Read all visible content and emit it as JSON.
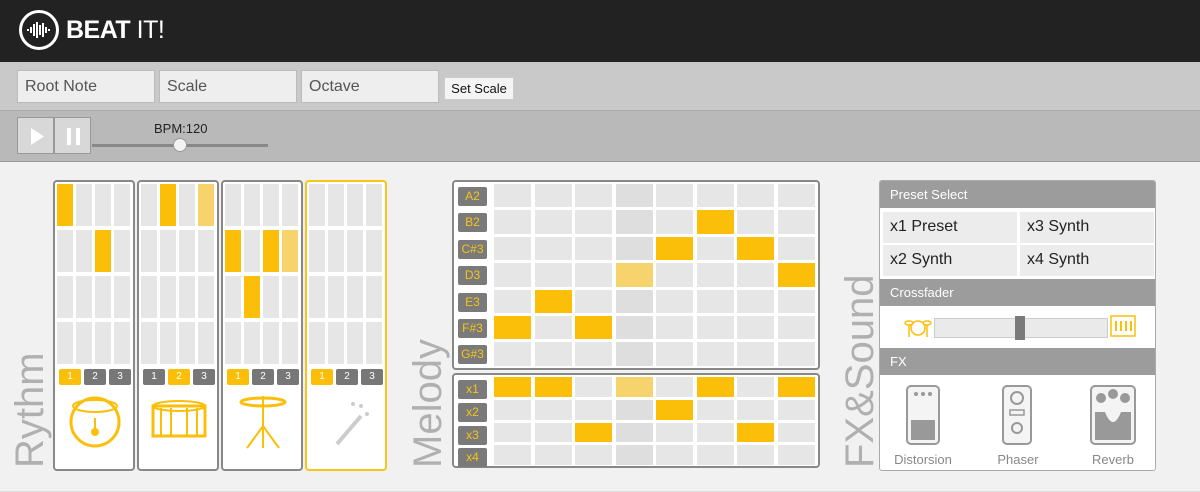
{
  "header": {
    "brand_bold": "BEAT",
    "brand_light": "IT!"
  },
  "scale_controls": {
    "root_note": "Root Note",
    "scale": "Scale",
    "octave": "Octave",
    "set_scale": "Set Scale"
  },
  "transport": {
    "bpm_label": "BPM:120",
    "bpm_value": 120,
    "play_icon": "play-icon",
    "pause_icon": "pause-icon"
  },
  "rhythm": {
    "label": "Rythm",
    "columns": [
      {
        "name": "kick",
        "icon": "bass-drum-icon",
        "selected_step": 1,
        "grid": [
          [
            1,
            0,
            0,
            0
          ],
          [
            0,
            0,
            1,
            0
          ],
          [
            0,
            0,
            0,
            0
          ],
          [
            0,
            0,
            0,
            0
          ]
        ]
      },
      {
        "name": "snare",
        "icon": "snare-drum-icon",
        "selected_step": 2,
        "grid": [
          [
            0,
            1,
            0,
            2
          ],
          [
            0,
            0,
            0,
            0
          ],
          [
            0,
            0,
            0,
            0
          ],
          [
            0,
            0,
            0,
            0
          ]
        ]
      },
      {
        "name": "hihat",
        "icon": "cymbal-icon",
        "selected_step": 1,
        "grid": [
          [
            0,
            0,
            0,
            0
          ],
          [
            1,
            0,
            1,
            2
          ],
          [
            0,
            1,
            0,
            0
          ],
          [
            0,
            0,
            0,
            0
          ]
        ]
      },
      {
        "name": "magic",
        "icon": "magic-wand-icon",
        "selected_step": 1,
        "grid": [
          [
            0,
            0,
            0,
            0
          ],
          [
            0,
            0,
            0,
            0
          ],
          [
            0,
            0,
            0,
            0
          ],
          [
            0,
            0,
            0,
            0
          ]
        ]
      }
    ],
    "step_labels": [
      "1",
      "2",
      "3"
    ]
  },
  "melody": {
    "label": "Melody",
    "notes": [
      "A2",
      "B2",
      "C#3",
      "D3",
      "E3",
      "F#3",
      "G#3"
    ],
    "note_grid": [
      [
        0,
        0,
        0,
        0,
        0,
        0,
        0,
        0
      ],
      [
        0,
        0,
        0,
        0,
        0,
        1,
        0,
        0
      ],
      [
        0,
        0,
        0,
        0,
        1,
        0,
        1,
        0
      ],
      [
        0,
        0,
        0,
        2,
        0,
        0,
        0,
        1
      ],
      [
        0,
        1,
        0,
        0,
        0,
        0,
        0,
        0
      ],
      [
        1,
        0,
        1,
        0,
        0,
        0,
        0,
        0
      ],
      [
        0,
        0,
        0,
        0,
        0,
        0,
        0,
        0
      ]
    ],
    "mults": [
      "x1",
      "x2",
      "x3",
      "x4"
    ],
    "mult_grid": [
      [
        1,
        1,
        0,
        2,
        0,
        1,
        0,
        1
      ],
      [
        0,
        0,
        0,
        0,
        1,
        0,
        0,
        0
      ],
      [
        0,
        0,
        1,
        0,
        0,
        0,
        1,
        0
      ],
      [
        0,
        0,
        0,
        0,
        0,
        0,
        0,
        0
      ]
    ]
  },
  "fx_sound": {
    "label": "FX&Sound",
    "preset_header": "Preset Select",
    "presets": [
      "x1 Preset",
      "x3 Synth",
      "x2 Synth",
      "x4 Synth"
    ],
    "crossfader_header": "Crossfader",
    "crossfader_value": 0.55,
    "fx_header": "FX",
    "effects": [
      "Distorsion",
      "Phaser",
      "Reverb"
    ]
  },
  "colors": {
    "accent": "#fbbf0a",
    "accent_light": "#f6d36c",
    "header_bg": "#222222"
  }
}
